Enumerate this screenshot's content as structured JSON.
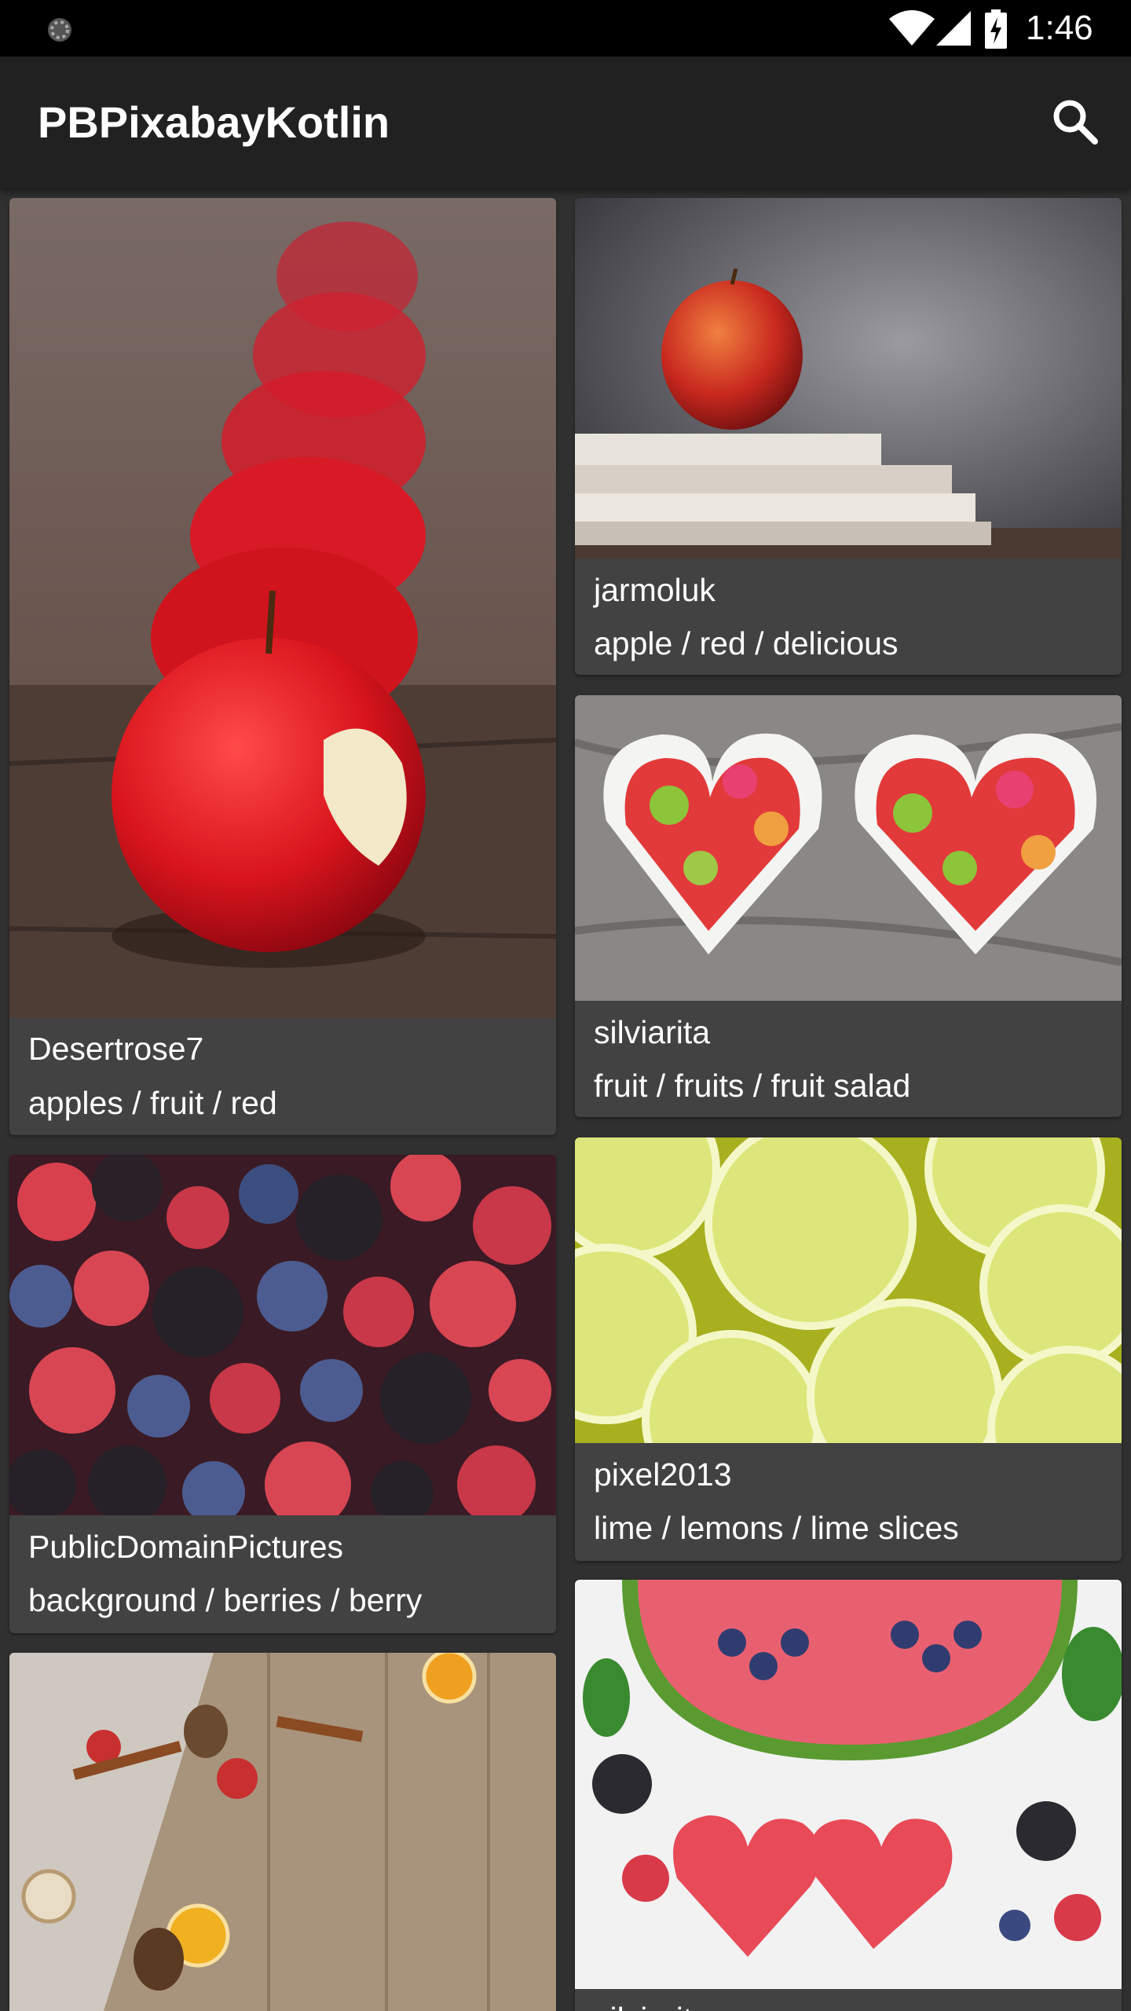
{
  "status_bar": {
    "time": "1:46",
    "icons": [
      "loading-icon",
      "wifi-icon",
      "cellular-signal-icon",
      "battery-charging-icon"
    ]
  },
  "app_bar": {
    "title": "PBPixabayKotlin",
    "search_icon": "search-icon"
  },
  "cards": [
    {
      "user": "Desertrose7",
      "tags": "apples / fruit / red",
      "image": "row of red apples, front apple bitten"
    },
    {
      "user": "jarmoluk",
      "tags": "apple / red / delicious",
      "image": "red apple on stack of books"
    },
    {
      "user": "silviarita",
      "tags": "fruit / fruits / fruit salad",
      "image": "two heart bowls of fruit salad"
    },
    {
      "user": "PublicDomainPictures",
      "tags": "background / berries / berry",
      "image": "mixed berries"
    },
    {
      "user": "pixel2013",
      "tags": "lime / lemons / lime slices",
      "image": "lime slices"
    },
    {
      "user": "",
      "tags": "",
      "image": "cinnamon, citrus slices and pine cones on wood"
    },
    {
      "user": "silviarita",
      "tags": "",
      "image": "watermelon hearts with berries"
    }
  ],
  "colors": {
    "status_bar": "#000000",
    "app_bar": "#212121",
    "background": "#303030",
    "card": "#424242",
    "text": "#ffffff"
  }
}
